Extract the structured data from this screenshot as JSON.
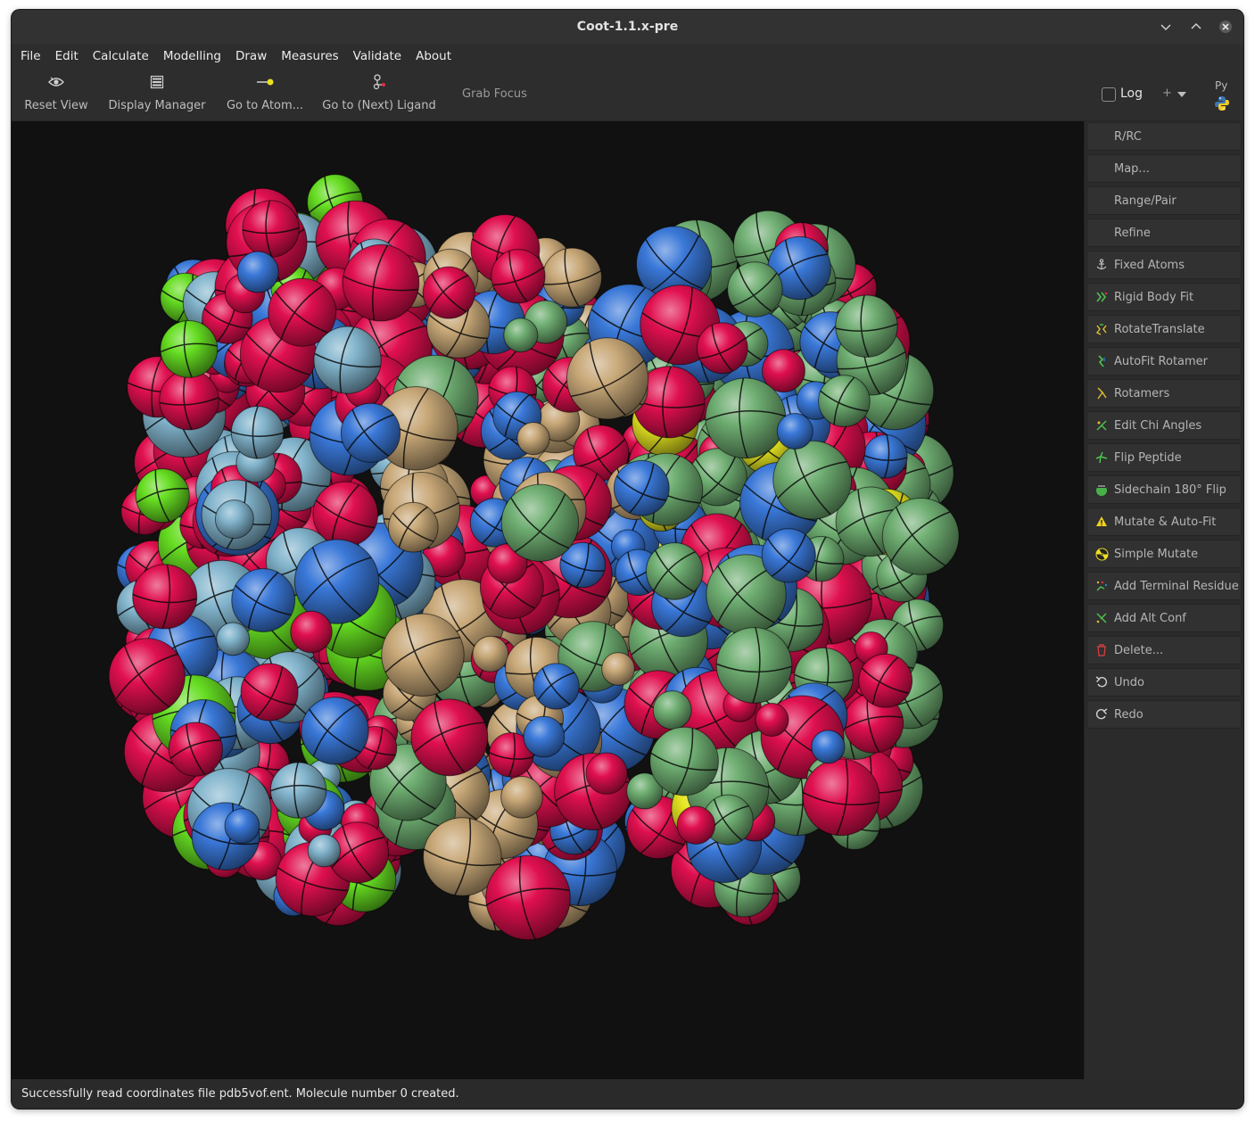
{
  "window": {
    "title": "Coot-1.1.x-pre"
  },
  "menu": [
    "File",
    "Edit",
    "Calculate",
    "Modelling",
    "Draw",
    "Measures",
    "Validate",
    "About"
  ],
  "toolbar": {
    "reset_view": "Reset View",
    "display_manager": "Display Manager",
    "go_to_atom": "Go to Atom...",
    "go_to_ligand": "Go to (Next) Ligand",
    "grab_focus": "Grab Focus",
    "log_label": "Log",
    "plus_label": "+",
    "py_label": "Py"
  },
  "sidebar": [
    {
      "label": "R/RC",
      "icon": ""
    },
    {
      "label": "Map...",
      "icon": ""
    },
    {
      "label": "Range/Pair",
      "icon": ""
    },
    {
      "label": "Refine",
      "icon": ""
    },
    {
      "label": "Fixed Atoms",
      "icon": "anchor-icon"
    },
    {
      "label": "Rigid Body Fit",
      "icon": "rigid-body-icon"
    },
    {
      "label": "RotateTranslate",
      "icon": "rotate-translate-icon"
    },
    {
      "label": "AutoFit Rotamer",
      "icon": "autofit-rotamer-icon"
    },
    {
      "label": "Rotamers",
      "icon": "rotamers-icon"
    },
    {
      "label": "Edit Chi Angles",
      "icon": "chi-angles-icon"
    },
    {
      "label": "Flip Peptide",
      "icon": "flip-peptide-icon"
    },
    {
      "label": "Sidechain 180° Flip",
      "icon": "sidechain-flip-icon"
    },
    {
      "label": "Mutate & Auto-Fit",
      "icon": "warning-triangle-icon"
    },
    {
      "label": "Simple Mutate",
      "icon": "radiation-icon"
    },
    {
      "label": "Add Terminal Residue",
      "icon": "terminal-residue-icon"
    },
    {
      "label": "Add Alt Conf",
      "icon": "alt-conf-icon"
    },
    {
      "label": "Delete...",
      "icon": "trash-icon"
    },
    {
      "label": "Undo",
      "icon": "undo-icon"
    },
    {
      "label": "Redo",
      "icon": "redo-icon"
    }
  ],
  "colors": {
    "oxygen": "#e0104f",
    "nitrogen": "#3a78d8",
    "carbon_tan": "#c8a878",
    "carbon_lightblue": "#82b4cc",
    "carbon_green": "#6fae72",
    "chlorine": "#66dd22",
    "sulfur": "#e6e622",
    "background": "#111111"
  },
  "status": {
    "message": "Successfully read coordinates file pdb5vof.ent.  Molecule number 0 created."
  }
}
